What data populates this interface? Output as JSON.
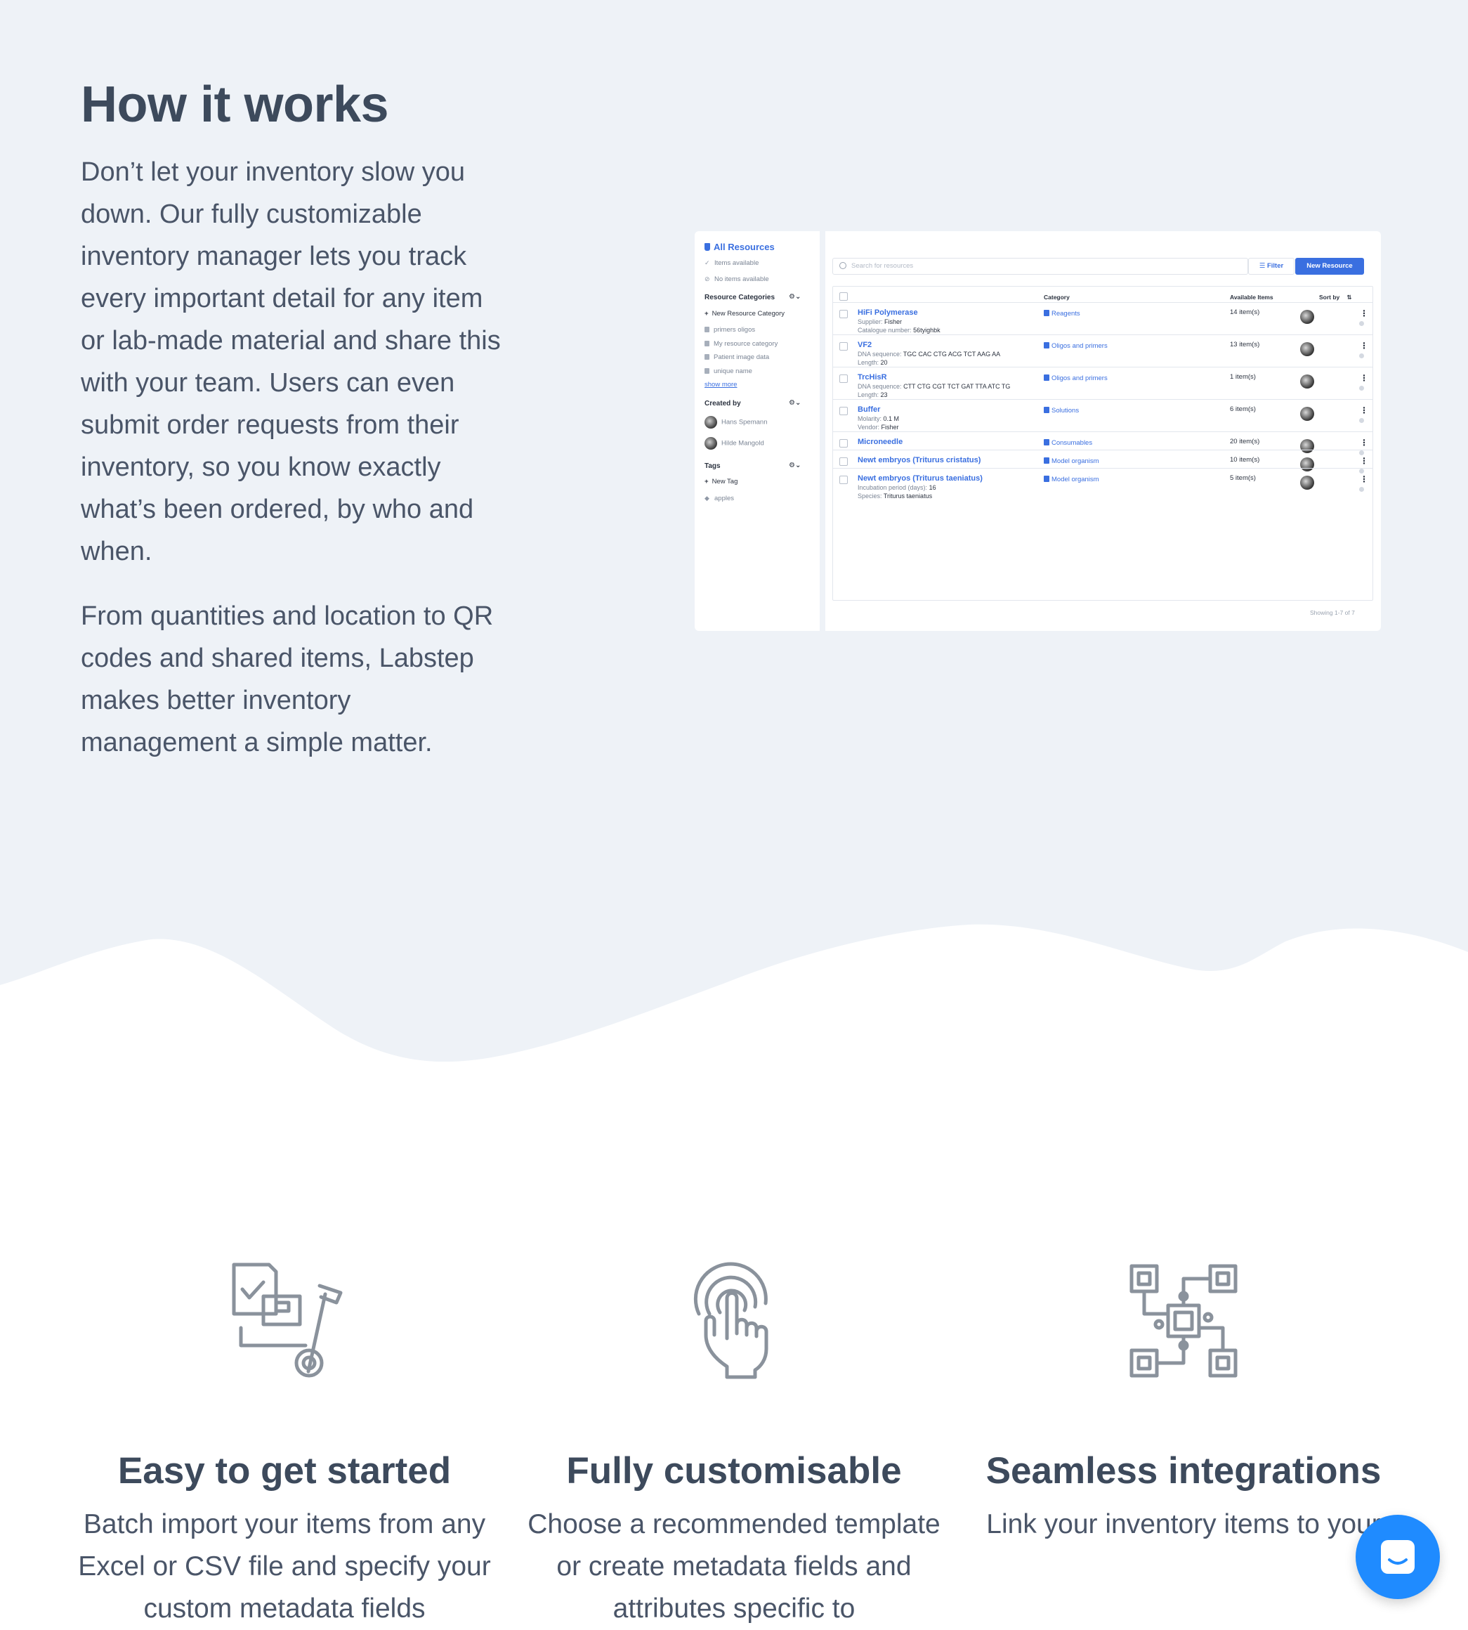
{
  "how": {
    "title": "How it works",
    "para1": "Don’t let your inventory slow you down. Our fully customizable inventory manager lets you track every important detail for any item or lab-made material and share this with your team. Users can even submit order requests from their inventory, so you know exactly what’s been ordered, by who and when.",
    "para2": "From quantities and location to QR codes and shared items, Labstep makes better inventory management a simple matter."
  },
  "screenshot": {
    "sidebar": {
      "all_resources": "All Resources",
      "items_available": "Items available",
      "no_items_available": "No items available",
      "resource_categories": "Resource Categories",
      "new_resource_category": "New Resource Category",
      "categories": [
        "primers oligos",
        "My resource category",
        "Patient image data",
        "unique name"
      ],
      "show_more": "show more",
      "created_by": "Created by",
      "creators": [
        "Hans Spemann",
        "Hilde Mangold"
      ],
      "tags": "Tags",
      "new_tag": "New Tag",
      "tag_items": [
        "apples"
      ]
    },
    "search_placeholder": "Search for resources",
    "filter_label": "Filter",
    "new_resource_label": "New Resource",
    "columns": {
      "category": "Category",
      "available": "Available Items",
      "sort_by": "Sort by"
    },
    "rows": [
      {
        "name": "HiFi Polymerase",
        "meta": [
          [
            "Supplier:",
            "Fisher"
          ],
          [
            "Catalogue number:",
            "56tyighbk"
          ]
        ],
        "category": "Reagents",
        "available": "14 item(s)"
      },
      {
        "name": "VF2",
        "meta": [
          [
            "DNA sequence:",
            "TGC CAC CTG ACG TCT AAG AA"
          ],
          [
            "Length:",
            "20"
          ]
        ],
        "category": "Oligos and primers",
        "available": "13 item(s)"
      },
      {
        "name": "TrcHisR",
        "meta": [
          [
            "DNA sequence:",
            "CTT CTG CGT TCT GAT TTA ATC TG"
          ],
          [
            "Length:",
            "23"
          ]
        ],
        "category": "Oligos and primers",
        "available": "1 item(s)"
      },
      {
        "name": "Buffer",
        "meta": [
          [
            "Molarity:",
            "0.1 M"
          ],
          [
            "Vendor:",
            "Fisher"
          ]
        ],
        "category": "Solutions",
        "available": "6 item(s)"
      },
      {
        "name": "Microneedle",
        "meta": [],
        "category": "Consumables",
        "available": "20 item(s)"
      },
      {
        "name": "Newt embryos (Triturus cristatus)",
        "meta": [],
        "category": "Model organism",
        "available": "10 item(s)"
      },
      {
        "name": "Newt embryos (Triturus taeniatus)",
        "meta": [
          [
            "Incubation period (days):",
            "16"
          ],
          [
            "Species:",
            "Triturus taeniatus"
          ]
        ],
        "category": "Model organism",
        "available": "5 item(s)"
      }
    ],
    "showing": "Showing 1-7 of 7"
  },
  "features": [
    {
      "title": "Easy to get started",
      "text": "Batch import your items from any Excel or CSV file and specify your custom metadata fields",
      "icon": "inventory-cart-icon"
    },
    {
      "title": "Fully customisable",
      "text": "Choose a recommended template or create metadata fields and attributes specific to",
      "icon": "touch-hand-icon"
    },
    {
      "title": "Seamless integrations",
      "text": "Link your inventory items to your",
      "icon": "circuit-nodes-icon"
    }
  ],
  "colors": {
    "accent": "#3a6fe0",
    "chat": "#1f8bff",
    "bg_top": "#eef2f7",
    "text": "#3d4a5c"
  }
}
